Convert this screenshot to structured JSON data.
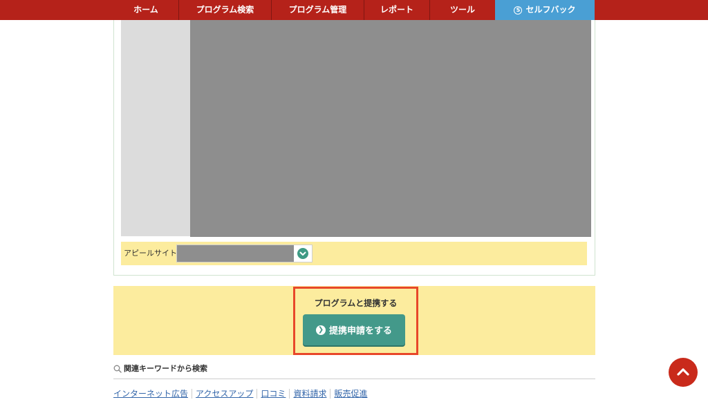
{
  "nav": {
    "items": [
      {
        "label": "ホーム"
      },
      {
        "label": "プログラム検索"
      },
      {
        "label": "プログラム管理"
      },
      {
        "label": "レポート"
      },
      {
        "label": "ツール"
      }
    ],
    "selfback": {
      "label": "セルフバック",
      "icon": "s-icon",
      "icon_char": "S"
    }
  },
  "appeal": {
    "label": "アピールサイト",
    "select_icon": "chevron-down-icon"
  },
  "cta": {
    "title": "プログラムと提携する",
    "button_label": "提携申請をする",
    "button_icon": "arrow-right-circle-icon",
    "button_icon_char": "❯"
  },
  "keywords": {
    "heading": "関連キーワードから検索",
    "heading_icon": "search-icon",
    "items": [
      "インターネット広告",
      "アクセスアップ",
      "口コミ",
      "資料請求",
      "販売促進"
    ]
  },
  "back_to_top": {
    "icon": "chevron-up-icon"
  },
  "colors": {
    "nav_bg": "#b5221a",
    "selfback_bg": "#4a9fd4",
    "cta_band_bg": "#fcec9e",
    "cta_button_bg": "#43998a",
    "highlight_border": "#e8472a",
    "to_top_bg": "#c92a1b"
  }
}
